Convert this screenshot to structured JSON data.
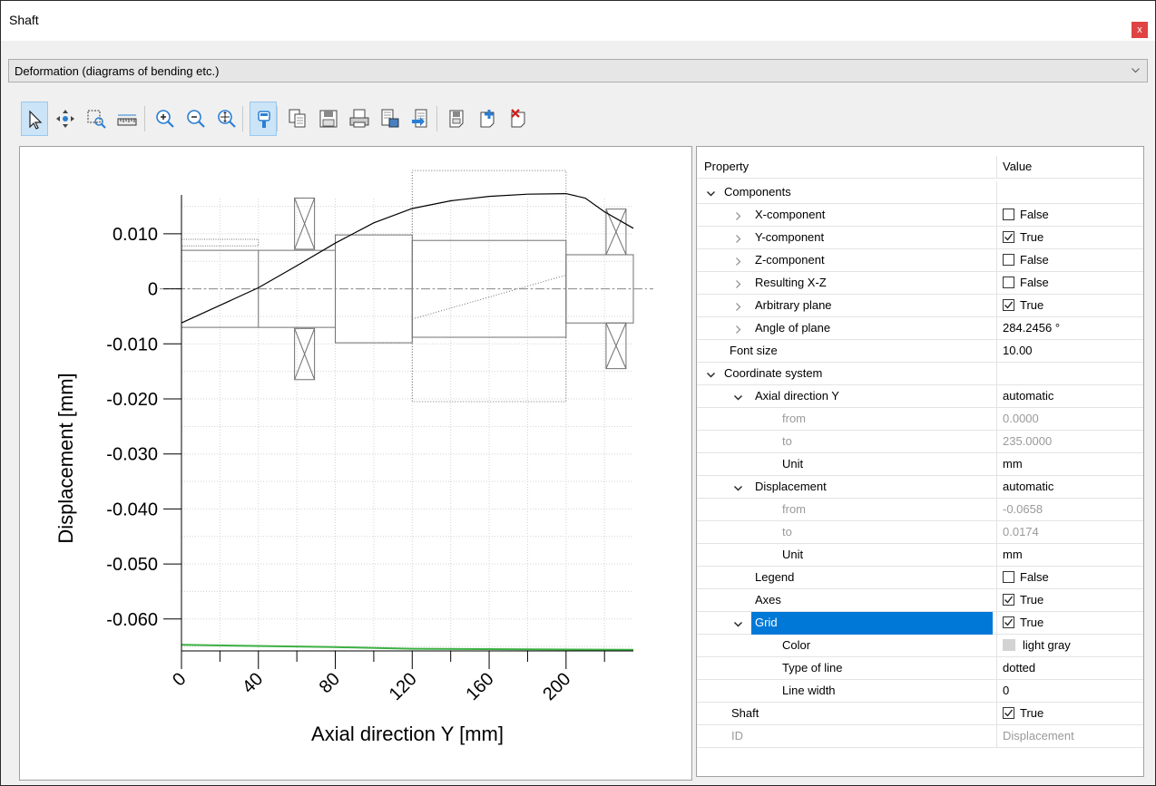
{
  "window": {
    "title": "Shaft",
    "close_label": "x"
  },
  "dropdown": {
    "selected": "Deformation (diagrams of bending etc.)"
  },
  "toolbar": {
    "buttons": [
      {
        "name": "select-pointer",
        "active": true
      },
      {
        "name": "pan"
      },
      {
        "name": "zoom-window"
      },
      {
        "name": "measure-ruler"
      },
      {
        "name": "zoom-in"
      },
      {
        "name": "zoom-out"
      },
      {
        "name": "zoom-fit"
      },
      {
        "name": "rolling-bearing",
        "active": true
      },
      {
        "name": "copy"
      },
      {
        "name": "save"
      },
      {
        "name": "print"
      },
      {
        "name": "paste-clipboard"
      },
      {
        "name": "export"
      },
      {
        "name": "save-diagram"
      },
      {
        "name": "add-diagram"
      },
      {
        "name": "delete-diagram"
      }
    ]
  },
  "chart_data": {
    "type": "line",
    "xlabel": "Axial direction Y [mm]",
    "ylabel": "Displacement [mm]",
    "xlim": [
      0,
      235
    ],
    "ylim": [
      -0.0658,
      0.0174
    ],
    "xticks": [
      "0",
      "40",
      "80",
      "120",
      "160",
      "200"
    ],
    "yticks": [
      "0.010",
      "0",
      "-0.010",
      "-0.020",
      "-0.030",
      "-0.040",
      "-0.050",
      "-0.060"
    ],
    "grid": true,
    "grid_color": "#d3d3d3",
    "series": [
      {
        "color": "#000000",
        "x": [
          0,
          20,
          40,
          60,
          80,
          100,
          120,
          140,
          160,
          180,
          200,
          210,
          220,
          235
        ],
        "values": [
          -0.0062,
          -0.003,
          0.0002,
          0.0042,
          0.0083,
          0.012,
          0.0146,
          0.016,
          0.0168,
          0.0172,
          0.0173,
          0.0165,
          0.014,
          0.011
        ]
      },
      {
        "color": "#3cb043",
        "x": [
          0,
          80,
          120,
          235
        ],
        "values": [
          -0.0647,
          -0.0651,
          -0.0654,
          -0.0656
        ]
      }
    ]
  },
  "properties": {
    "header": {
      "property": "Property",
      "value": "Value"
    },
    "rows": [
      {
        "label": "Components",
        "indent": 0,
        "expander": "open",
        "value": "",
        "check": null
      },
      {
        "label": "X-component",
        "indent": 1,
        "expander": "closed",
        "value": "False",
        "check": false
      },
      {
        "label": "Y-component",
        "indent": 1,
        "expander": "closed",
        "value": "True",
        "check": true
      },
      {
        "label": "Z-component",
        "indent": 1,
        "expander": "closed",
        "value": "False",
        "check": false
      },
      {
        "label": "Resulting X-Z",
        "indent": 1,
        "expander": "closed",
        "value": "False",
        "check": false
      },
      {
        "label": "Arbitrary plane",
        "indent": 1,
        "expander": "closed",
        "value": "True",
        "check": true
      },
      {
        "label": "Angle of plane",
        "indent": 1,
        "expander": "closed",
        "value": "284.2456 °",
        "check": null
      },
      {
        "label": "Font size",
        "indent": 0,
        "expander": "none",
        "value": "10.00",
        "check": null
      },
      {
        "label": "Coordinate system",
        "indent": 0,
        "expander": "open",
        "value": "",
        "check": null
      },
      {
        "label": "Axial direction Y",
        "indent": 1,
        "expander": "open",
        "value": "automatic",
        "check": null
      },
      {
        "label": "from",
        "indent": 2,
        "expander": "none",
        "value": "0.0000",
        "check": null,
        "gray": true
      },
      {
        "label": "to",
        "indent": 2,
        "expander": "none",
        "value": "235.0000",
        "check": null,
        "gray": true
      },
      {
        "label": "Unit",
        "indent": 2,
        "expander": "none",
        "value": "mm",
        "check": null
      },
      {
        "label": "Displacement",
        "indent": 1,
        "expander": "open",
        "value": "automatic",
        "check": null
      },
      {
        "label": "from",
        "indent": 2,
        "expander": "none",
        "value": "-0.0658",
        "check": null,
        "gray": true
      },
      {
        "label": "to",
        "indent": 2,
        "expander": "none",
        "value": "0.0174",
        "check": null,
        "gray": true
      },
      {
        "label": "Unit",
        "indent": 2,
        "expander": "none",
        "value": "mm",
        "check": null
      },
      {
        "label": "Legend",
        "indent": 1,
        "expander": "none",
        "value": "False",
        "check": false
      },
      {
        "label": "Axes",
        "indent": 1,
        "expander": "none",
        "value": "True",
        "check": true
      },
      {
        "label": "Grid",
        "indent": 1,
        "expander": "open",
        "value": "True",
        "check": true,
        "selected": true
      },
      {
        "label": "Color",
        "indent": 2,
        "expander": "none",
        "value": "light gray",
        "check": null,
        "swatch": "#d3d3d3"
      },
      {
        "label": "Type of line",
        "indent": 2,
        "expander": "none",
        "value": "dotted",
        "check": null
      },
      {
        "label": "Line width",
        "indent": 2,
        "expander": "none",
        "value": "0",
        "check": null
      },
      {
        "label": "Shaft",
        "indent": 0,
        "expander": "none",
        "value": "True",
        "check": true
      },
      {
        "label": "ID",
        "indent": 0,
        "expander": "none",
        "value": "Displacement",
        "check": null,
        "gray": true
      }
    ]
  }
}
